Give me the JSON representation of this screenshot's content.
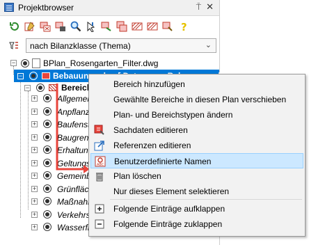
{
  "panel": {
    "title": "Projektbrowser",
    "pin_glyph": "⍑",
    "close_glyph": "✕"
  },
  "filter": {
    "icon": "filter-icon",
    "selected": "nach Bilanzklasse (Thema)"
  },
  "tree": {
    "root": "BPlan_Rosengarten_Filter.dwg",
    "plan": "Bebauungsplan [ Daten zum Bebauungsplan ]",
    "bereich": "Bereich",
    "items": [
      "Allgemeine",
      "Anpflanzungen",
      "Baufenster",
      "Baugrenzen",
      "Erhaltungen",
      "Geltungsbereich",
      "Gemeinbedarf",
      "Grünflächen",
      "Maßnahmen",
      "Verkehrsflächen",
      "Wasserflächen"
    ]
  },
  "context_menu": {
    "items": [
      {
        "label": "Bereich hinzufügen",
        "icon": ""
      },
      {
        "label": "Gewählte Bereiche in diesen Plan verschieben",
        "icon": ""
      },
      {
        "label": "Plan- und Bereichstypen ändern",
        "icon": ""
      },
      {
        "label": "Sachdaten editieren",
        "icon": "edit-data-icon"
      },
      {
        "label": "Referenzen editieren",
        "icon": "reference-icon"
      },
      {
        "label": "Benutzerdefinierte Namen",
        "icon": "custom-names-icon"
      },
      {
        "label": "Plan löschen",
        "icon": "trash-icon"
      },
      {
        "label": "Nur dieses Element selektieren",
        "icon": ""
      },
      {
        "label": "Folgende Einträge aufklappen",
        "icon": "expand-icon"
      },
      {
        "label": "Folgende Einträge zuklappen",
        "icon": "collapse-icon"
      }
    ]
  },
  "colors": {
    "selection": "#0078d7",
    "highlight": "#cce8ff",
    "arrow": "#e8453c"
  }
}
